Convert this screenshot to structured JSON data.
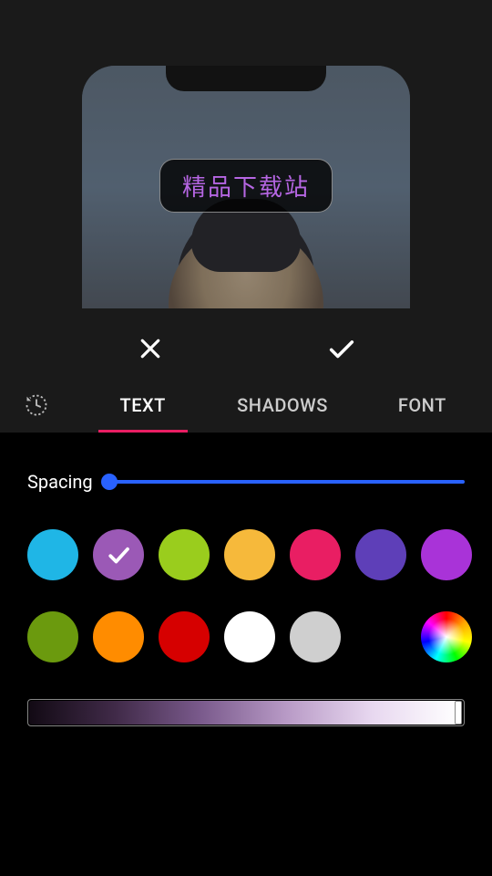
{
  "preview": {
    "text": "精品下载站",
    "text_color": "#b666e3"
  },
  "actions": {
    "close": "close",
    "confirm": "confirm"
  },
  "tabs": {
    "history": "history",
    "items": [
      {
        "id": "text",
        "label": "TEXT",
        "active": true
      },
      {
        "id": "shadows",
        "label": "SHADOWS",
        "active": false
      },
      {
        "id": "font",
        "label": "FONT",
        "active": false
      }
    ]
  },
  "panel": {
    "spacing": {
      "label": "Spacing",
      "value": 0,
      "min": 0,
      "max": 100
    },
    "colors": [
      {
        "hex": "#1fb6e6",
        "selected": false
      },
      {
        "hex": "#9b59b6",
        "selected": true
      },
      {
        "hex": "#9acd1d",
        "selected": false
      },
      {
        "hex": "#f6b93b",
        "selected": false
      },
      {
        "hex": "#e91e63",
        "selected": false
      },
      {
        "hex": "#5e3fb8",
        "selected": false
      },
      {
        "hex": "#a933d8",
        "selected": false
      },
      {
        "hex": "#6b9a0e",
        "selected": false
      },
      {
        "hex": "#ff8c00",
        "selected": false
      },
      {
        "hex": "#d60000",
        "selected": false
      },
      {
        "hex": "#ffffff",
        "selected": false
      },
      {
        "hex": "#cfcfcf",
        "selected": false
      },
      {
        "hex": "#000000",
        "selected": false
      },
      {
        "hex": "rainbow",
        "selected": false
      }
    ],
    "brightness": {
      "value": 100,
      "min": 0,
      "max": 100,
      "base_color": "#b666e3"
    }
  }
}
